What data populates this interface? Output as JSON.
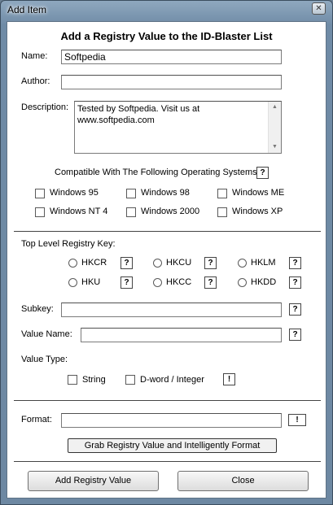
{
  "window": {
    "title": "Add Item",
    "close_glyph": "✕"
  },
  "heading": "Add a Registry Value to the ID-Blaster List",
  "fields": {
    "name_label": "Name:",
    "name_value": "Softpedia",
    "author_label": "Author:",
    "author_value": "",
    "description_label": "Description:",
    "description_value": "Tested by Softpedia. Visit us at www.softpedia.com"
  },
  "os": {
    "label": "Compatible With The Following Operating Systems:",
    "options": [
      "Windows 95",
      "Windows 98",
      "Windows ME",
      "Windows NT 4",
      "Windows 2000",
      "Windows XP"
    ]
  },
  "registry": {
    "label": "Top Level Registry Key:",
    "keys": [
      "HKCR",
      "HKCU",
      "HKLM",
      "HKU",
      "HKCC",
      "HKDD"
    ],
    "subkey_label": "Subkey:",
    "subkey_value": "",
    "value_name_label": "Value Name:",
    "value_name_value": "",
    "value_type_label": "Value Type:",
    "type_string": "String",
    "type_dword": "D-word / Integer"
  },
  "format": {
    "label": "Format:",
    "value": "",
    "grab_button": "Grab Registry Value and Intelligently Format"
  },
  "buttons": {
    "add": "Add Registry Value",
    "close": "Close"
  },
  "glyphs": {
    "help": "?",
    "info": "!",
    "scroll_up": "▲",
    "scroll_down": "▼"
  }
}
